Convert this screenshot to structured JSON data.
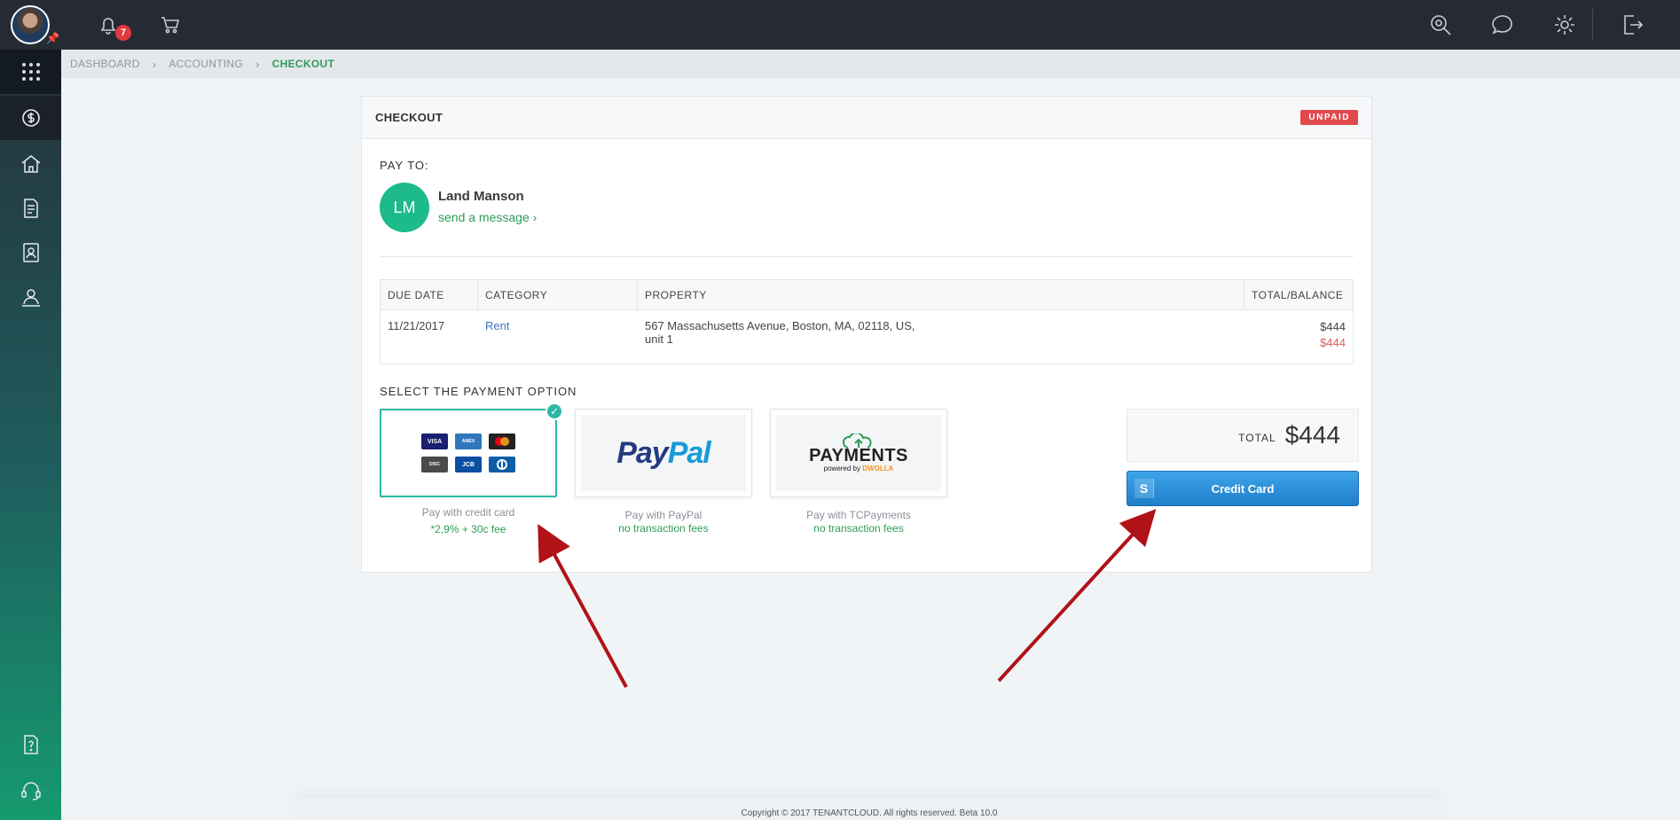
{
  "header": {
    "notifications_count": "7"
  },
  "breadcrumb": {
    "items": [
      "DASHBOARD",
      "ACCOUNTING",
      "CHECKOUT"
    ]
  },
  "checkout": {
    "title": "CHECKOUT",
    "status": "UNPAID",
    "pay_to_label": "PAY TO:",
    "payee": {
      "initials": "LM",
      "name": "Land Manson",
      "message_link": "send a message ›"
    },
    "table": {
      "headers": [
        "DUE DATE",
        "CATEGORY",
        "PROPERTY",
        "TOTAL/BALANCE"
      ],
      "rows": [
        {
          "due_date": "11/21/2017",
          "category": "Rent",
          "property_line1": "567 Massachusetts Avenue, Boston, MA, 02118, US,",
          "property_line2": "unit 1",
          "total": "$444",
          "balance": "$444"
        }
      ]
    },
    "select_label": "SELECT THE PAYMENT OPTION",
    "options": [
      {
        "caption": "Pay with credit card",
        "fee": "*2,9% + 30c fee",
        "cards": [
          "VISA",
          "AMEX",
          "MC",
          "DISC",
          "JCB",
          "DC"
        ]
      },
      {
        "caption": "Pay with PayPal",
        "fee": "no transaction fees",
        "logo_a": "Pay",
        "logo_b": "Pal"
      },
      {
        "caption": "Pay with TCPayments",
        "fee": "no transaction fees",
        "logo": "PAYMENTS",
        "logo_sub_a": "powered by ",
        "logo_sub_b": "DWOLLA"
      }
    ],
    "total_label": "TOTAL",
    "total_amount": "$444",
    "pay_button": "Credit Card",
    "pay_button_icon": "S"
  },
  "footer": {
    "text": "Copyright © 2017 TENANTCLOUD. All rights reserved. Beta 10.0"
  },
  "colors": {
    "accent_green": "#2e9c55",
    "unpaid_red": "#e04a4f",
    "button_blue": "#1f7fc9",
    "selection_teal": "#2bb8a6",
    "annotation_arrow": "#b01217"
  }
}
